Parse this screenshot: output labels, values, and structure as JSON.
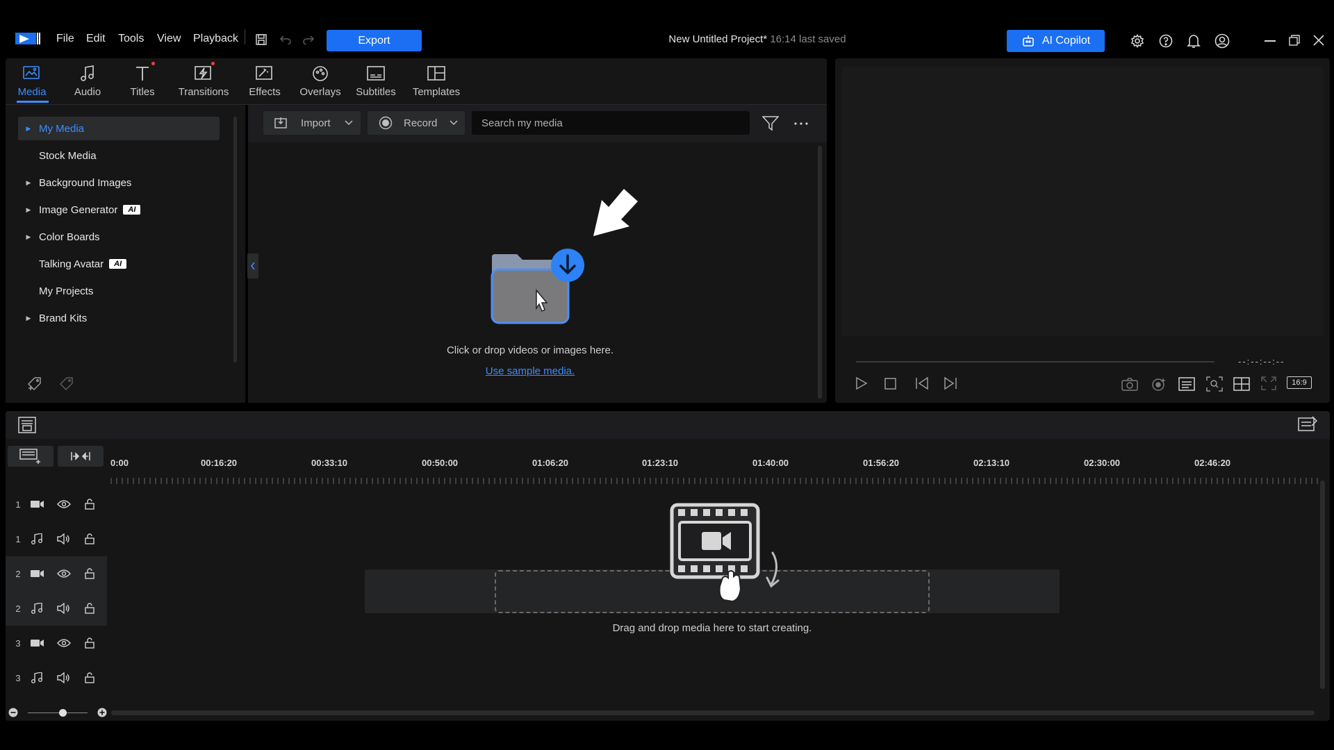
{
  "app": {
    "menu": [
      "File",
      "Edit",
      "Tools",
      "View",
      "Playback"
    ],
    "export_label": "Export",
    "project_title": "New Untitled Project*",
    "saved_status": "16:14 last saved",
    "copilot_label": "AI Copilot"
  },
  "tabs": [
    {
      "label": "Media",
      "icon": "media-icon",
      "active": true
    },
    {
      "label": "Audio",
      "icon": "music-note-icon"
    },
    {
      "label": "Titles",
      "icon": "text-icon",
      "new_dot": true
    },
    {
      "label": "Transitions",
      "icon": "transition-icon",
      "new_dot": true
    },
    {
      "label": "Effects",
      "icon": "effects-icon"
    },
    {
      "label": "Overlays",
      "icon": "overlays-icon"
    },
    {
      "label": "Subtitles",
      "icon": "subtitles-icon"
    },
    {
      "label": "Templates",
      "icon": "templates-icon"
    }
  ],
  "sidebar": {
    "items": [
      {
        "label": "My Media",
        "expandable": true,
        "selected": true
      },
      {
        "label": "Stock Media",
        "expandable": false
      },
      {
        "label": "Background Images",
        "expandable": true
      },
      {
        "label": "Image Generator",
        "expandable": true,
        "badge": "AI"
      },
      {
        "label": "Color Boards",
        "expandable": true
      },
      {
        "label": "Talking Avatar",
        "expandable": false,
        "badge": "AI"
      },
      {
        "label": "My Projects",
        "expandable": false
      },
      {
        "label": "Brand Kits",
        "expandable": true
      }
    ]
  },
  "media_toolbar": {
    "import_label": "Import",
    "record_label": "Record",
    "search_placeholder": "Search my media"
  },
  "media_area": {
    "empty_text": "Click or drop videos or images here.",
    "sample_link": "Use sample media."
  },
  "preview": {
    "timecode": "--:--:--:--",
    "aspect_ratio": "16:9"
  },
  "timeline": {
    "ruler": [
      "0:00",
      "00:16:20",
      "00:33:10",
      "00:50:00",
      "01:06:20",
      "01:23:10",
      "01:40:00",
      "01:56:20",
      "02:13:10",
      "02:30:00",
      "02:46:20"
    ],
    "tracks": [
      {
        "num": "1",
        "type": "video"
      },
      {
        "num": "1",
        "type": "audio"
      },
      {
        "num": "2",
        "type": "video"
      },
      {
        "num": "2",
        "type": "audio"
      },
      {
        "num": "3",
        "type": "video"
      },
      {
        "num": "3",
        "type": "audio"
      }
    ],
    "drop_hint": "Drag and drop media here to start creating."
  },
  "colors": {
    "accent": "#1b6ff2",
    "active_tab": "#3b8dff",
    "panel_bg": "#161617",
    "notification_dot": "#ff3b3b"
  }
}
